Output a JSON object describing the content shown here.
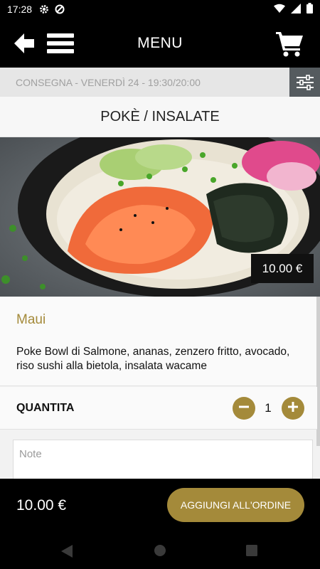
{
  "status_bar": {
    "time": "17:28",
    "icons": [
      "gear-icon",
      "data-saver-icon",
      "wifi-icon",
      "signal-icon",
      "battery-icon"
    ]
  },
  "app_bar": {
    "title": "MENU",
    "icons": [
      "back-arrow-icon",
      "hamburger-menu-icon",
      "cart-icon"
    ]
  },
  "delivery": {
    "text": "CONSEGNA - VENERDÌ 24 - 19:30/20:00",
    "icon": "filter-sliders-icon"
  },
  "category": {
    "title": "POKÈ / INSALATE"
  },
  "product": {
    "image": "poke-bowl-photo",
    "price": "10.00 €",
    "name": "Maui",
    "description": "Poke Bowl di Salmone, ananas, zenzero fritto, avocado, riso sushi alla bietola, insalata wacame"
  },
  "quantity": {
    "label": "QUANTITA",
    "value": "1",
    "icons": [
      "minus-icon",
      "plus-icon"
    ]
  },
  "notes": {
    "placeholder": "Note",
    "value": ""
  },
  "footer": {
    "total": "10.00 €",
    "add_button": "AGGIUNGI ALL'ORDINE"
  },
  "nav": {
    "icons": [
      "nav-back-icon",
      "nav-home-icon",
      "nav-recents-icon"
    ]
  },
  "colors": {
    "accent": "#a48a3a",
    "bar": "#000000",
    "filter_bg": "#555b5f"
  }
}
